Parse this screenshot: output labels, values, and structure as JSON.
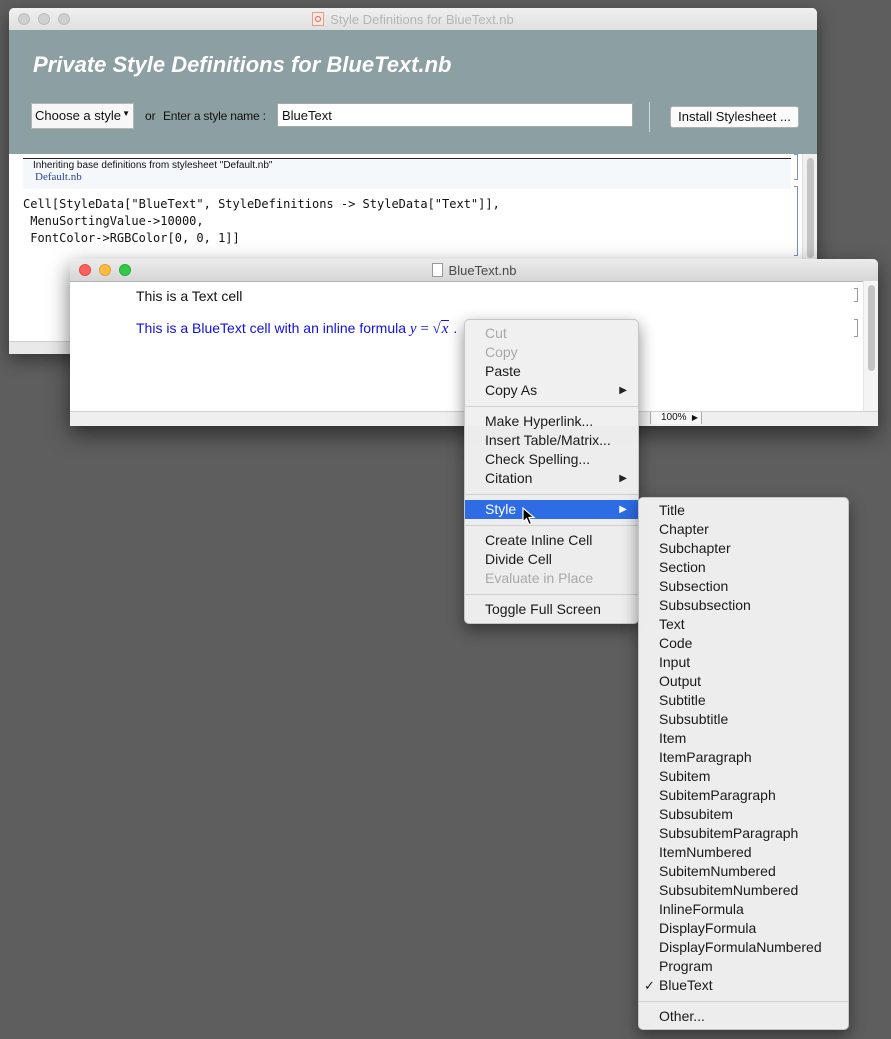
{
  "style_window": {
    "title": "Style Definitions for BlueText.nb",
    "heading": "Private Style Definitions for  BlueText.nb",
    "choose_style_label": "Choose a style",
    "or_label": "or",
    "enter_label": "Enter a style name :",
    "style_name_value": "BlueText",
    "install_button": "Install Stylesheet ...",
    "inherit_text": "Inheriting base definitions from stylesheet \"Default.nb\"",
    "inherit_link": "Default.nb",
    "code_lines": [
      "Cell[StyleData[\"BlueText\", StyleDefinitions -> StyleData[\"Text\"]],",
      " MenuSortingValue->10000,",
      " FontColor->RGBColor[0, 0, 1]]"
    ]
  },
  "notebook_window": {
    "title": "BlueText.nb",
    "text_cell": "This is a Text cell",
    "bluetext_cell": "This is a BlueText cell with an inline formula ",
    "formula_lhs": "y",
    "formula_eq": " = ",
    "formula_radical": "√",
    "formula_radicand": "x",
    "formula_tail": " .",
    "zoom": "100%"
  },
  "context_menu": {
    "items": [
      {
        "label": "Cut",
        "disabled": true
      },
      {
        "label": "Copy",
        "disabled": true
      },
      {
        "label": "Paste",
        "disabled": false
      },
      {
        "label": "Copy As",
        "disabled": false,
        "submenu": true
      },
      {
        "label": "Make Hyperlink...",
        "disabled": false
      },
      {
        "label": "Insert Table/Matrix...",
        "disabled": false
      },
      {
        "label": "Check Spelling...",
        "disabled": false
      },
      {
        "label": "Citation",
        "disabled": false,
        "submenu": true
      },
      {
        "label": "Style",
        "disabled": false,
        "submenu": true,
        "highlighted": true
      },
      {
        "label": "Create Inline Cell",
        "disabled": false
      },
      {
        "label": "Divide Cell",
        "disabled": false
      },
      {
        "label": "Evaluate in Place",
        "disabled": true
      },
      {
        "label": "Toggle Full Screen",
        "disabled": false
      }
    ],
    "submenu_arrow": "▶"
  },
  "style_submenu": {
    "items": [
      "Title",
      "Chapter",
      "Subchapter",
      "Section",
      "Subsection",
      "Subsubsection",
      "Text",
      "Code",
      "Input",
      "Output",
      "Subtitle",
      "Subsubtitle",
      "Item",
      "ItemParagraph",
      "Subitem",
      "SubitemParagraph",
      "Subsubitem",
      "SubsubitemParagraph",
      "ItemNumbered",
      "SubitemNumbered",
      "SubsubitemNumbered",
      "InlineFormula",
      "DisplayFormula",
      "DisplayFormulaNumbered",
      "Program",
      "BlueText"
    ],
    "checked": "BlueText",
    "check_mark": "✓",
    "other": "Other..."
  },
  "colors": {
    "header_bg": "#8c9fa3",
    "menu_highlight": "#2d6ce4",
    "blue_text": "#1010e0",
    "desktop": "#5e5e5e"
  }
}
